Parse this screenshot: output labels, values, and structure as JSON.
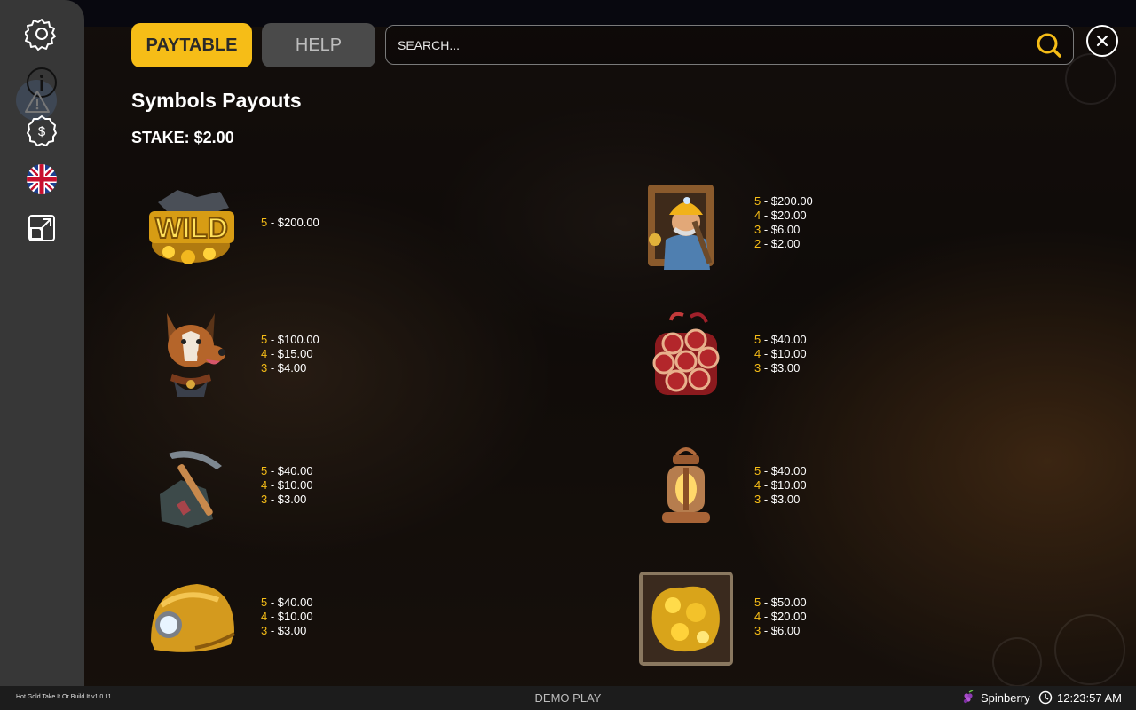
{
  "tabs": {
    "paytable": "PAYTABLE",
    "help": "HELP"
  },
  "search": {
    "placeholder": "SEARCH..."
  },
  "heading": {
    "title": "Symbols Payouts",
    "stake": "STAKE: $2.00"
  },
  "sidebar": {
    "icons": [
      "gear-icon",
      "info-icon",
      "warning-icon",
      "dollar-badge-icon",
      "uk-flag-icon",
      "open-external-icon"
    ]
  },
  "symbols": [
    {
      "name": "wild",
      "payouts": [
        {
          "count": "5",
          "amount": "$200.00"
        }
      ]
    },
    {
      "name": "miner",
      "payouts": [
        {
          "count": "5",
          "amount": "$200.00"
        },
        {
          "count": "4",
          "amount": "$20.00"
        },
        {
          "count": "3",
          "amount": "$6.00"
        },
        {
          "count": "2",
          "amount": "$2.00"
        }
      ]
    },
    {
      "name": "dog",
      "payouts": [
        {
          "count": "5",
          "amount": "$100.00"
        },
        {
          "count": "4",
          "amount": "$15.00"
        },
        {
          "count": "3",
          "amount": "$4.00"
        }
      ]
    },
    {
      "name": "dynamite",
      "payouts": [
        {
          "count": "5",
          "amount": "$40.00"
        },
        {
          "count": "4",
          "amount": "$10.00"
        },
        {
          "count": "3",
          "amount": "$3.00"
        }
      ]
    },
    {
      "name": "pickaxe",
      "payouts": [
        {
          "count": "5",
          "amount": "$40.00"
        },
        {
          "count": "4",
          "amount": "$10.00"
        },
        {
          "count": "3",
          "amount": "$3.00"
        }
      ]
    },
    {
      "name": "lantern",
      "payouts": [
        {
          "count": "5",
          "amount": "$40.00"
        },
        {
          "count": "4",
          "amount": "$10.00"
        },
        {
          "count": "3",
          "amount": "$3.00"
        }
      ]
    },
    {
      "name": "helmet",
      "payouts": [
        {
          "count": "5",
          "amount": "$40.00"
        },
        {
          "count": "4",
          "amount": "$10.00"
        },
        {
          "count": "3",
          "amount": "$3.00"
        }
      ]
    },
    {
      "name": "gold-nugget",
      "payouts": [
        {
          "count": "5",
          "amount": "$50.00"
        },
        {
          "count": "4",
          "amount": "$20.00"
        },
        {
          "count": "3",
          "amount": "$6.00"
        }
      ]
    }
  ],
  "footer": {
    "version": "Hot Gold Take It Or Build It v1.0.11",
    "mode": "DEMO PLAY",
    "brand": "Spinberry",
    "time": "12:23:57 AM"
  },
  "colors": {
    "accent": "#f6bd17",
    "sidebar": "#373737",
    "help_tab": "#4a4a4a",
    "footer": "#1c1c1c"
  }
}
